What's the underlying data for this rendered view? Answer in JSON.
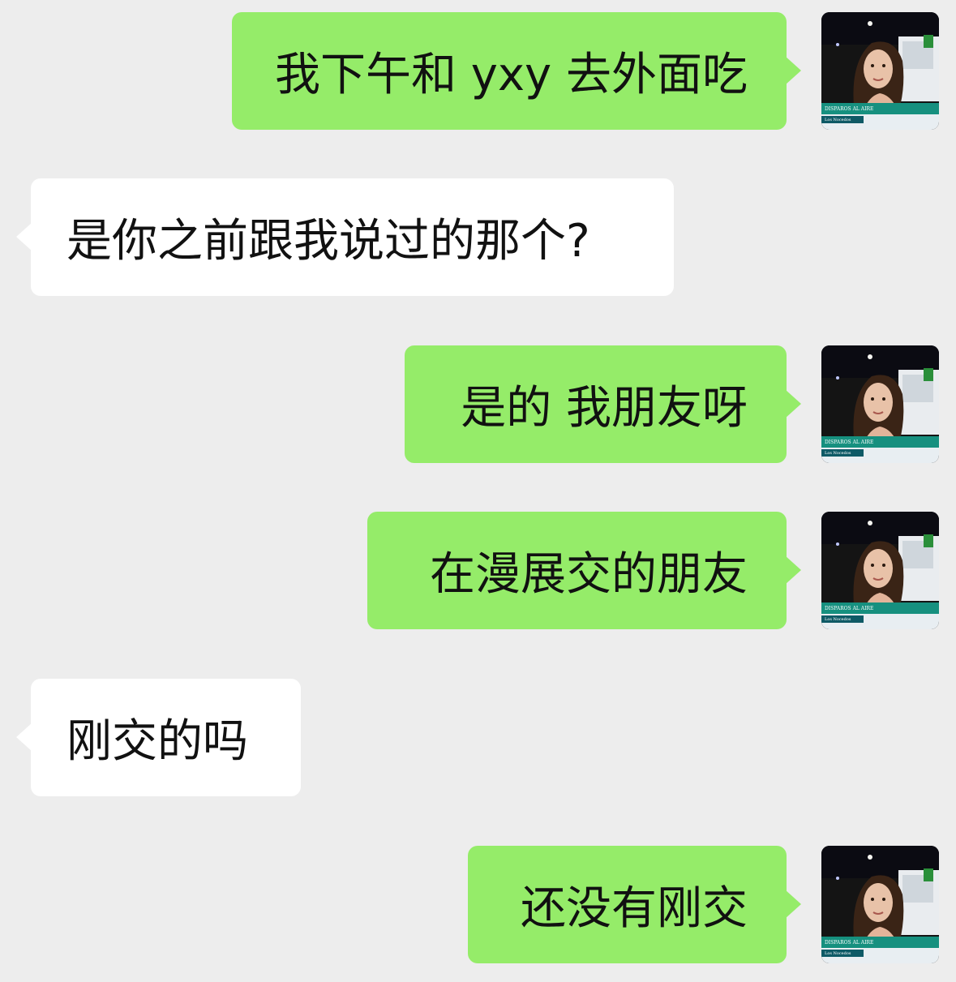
{
  "chat": {
    "messages": [
      {
        "side": "sent",
        "text": "我下午和 yxy 去外面吃"
      },
      {
        "side": "received",
        "text": "是你之前跟我说过的那个?"
      },
      {
        "side": "sent",
        "text": "是的 我朋友呀"
      },
      {
        "side": "sent",
        "text": "在漫展交的朋友"
      },
      {
        "side": "received",
        "text": "刚交的吗"
      },
      {
        "side": "sent",
        "text": "还没有刚交"
      }
    ]
  },
  "colors": {
    "background": "#ededed",
    "sent_bubble": "#95ec69",
    "received_bubble": "#ffffff",
    "text": "#111111"
  },
  "avatar": {
    "icon": "profile-photo-icon",
    "caption_line1": "DISPAROS AL AIRE",
    "caption_line2": "Los Nocedos"
  }
}
